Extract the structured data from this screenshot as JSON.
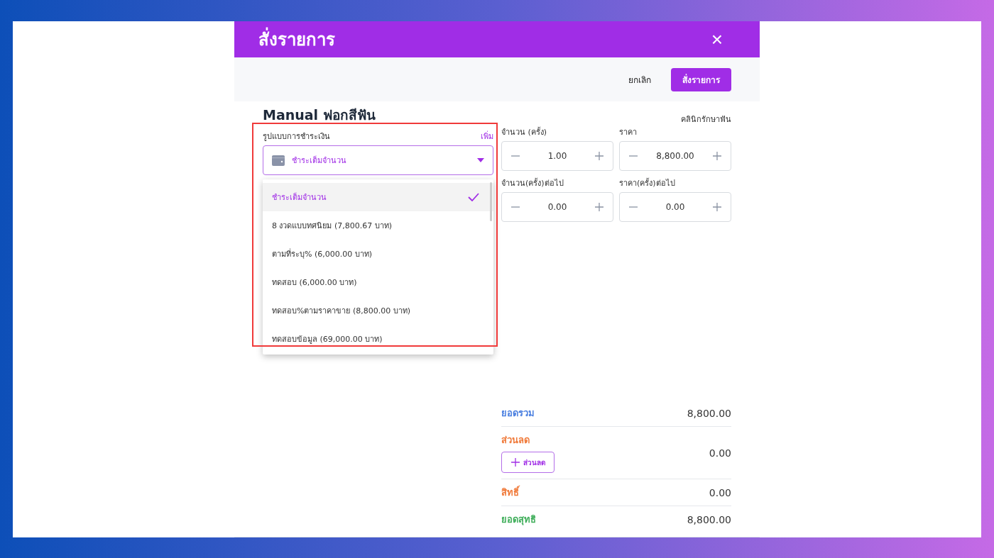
{
  "dialog": {
    "title": "สั่งรายการ",
    "close": "×"
  },
  "toolbar": {
    "cancel": "ยกเลิก",
    "submit": "สั่งรายการ"
  },
  "product": {
    "name": "Manual ฟอกสีฟัน",
    "branch": "คลินิกรักษาฟัน"
  },
  "payment": {
    "label": "รูปแบบการชำระเงิน",
    "add": "เพิ่ม",
    "value": "ชำระเต็มจำนวน",
    "expanded": true,
    "options": [
      {
        "label": "ชำระเต็มจำนวน",
        "selected": true
      },
      {
        "label": "8 งวดแบบทศนิยม (7,800.67 บาท)",
        "selected": false
      },
      {
        "label": "ตามที่ระบุ% (6,000.00 บาท)",
        "selected": false
      },
      {
        "label": "ทดสอบ (6,000.00 บาท)",
        "selected": false
      },
      {
        "label": "ทดสอบ%ตามราคาขาย (8,800.00 บาท)",
        "selected": false
      },
      {
        "label": "ทดสอบข้อมูล (69,000.00 บาท)",
        "selected": false
      }
    ]
  },
  "steppers": [
    {
      "label": "จำนวน (ครั้ง)",
      "value": "1.00"
    },
    {
      "label": "ราคา",
      "value": "8,800.00"
    },
    {
      "label": "จำนวน(ครั้ง)ต่อไป",
      "value": "0.00"
    },
    {
      "label": "ราคา(ครั้ง)ต่อไป",
      "value": "0.00"
    }
  ],
  "summary": [
    {
      "kind": "plain",
      "label": "ยอดรวม",
      "value": "8,800.00",
      "color": "#4a7fe0"
    },
    {
      "kind": "discount",
      "label": "ส่วนลด",
      "value": "0.00",
      "color": "#f07a3a",
      "button": "ส่วนลด"
    },
    {
      "kind": "plain",
      "label": "สิทธิ์",
      "value": "0.00",
      "color": "#f07a3a"
    },
    {
      "kind": "plain",
      "label": "ยอดสุทธิ",
      "value": "8,800.00",
      "color": "#3fae5a"
    }
  ]
}
